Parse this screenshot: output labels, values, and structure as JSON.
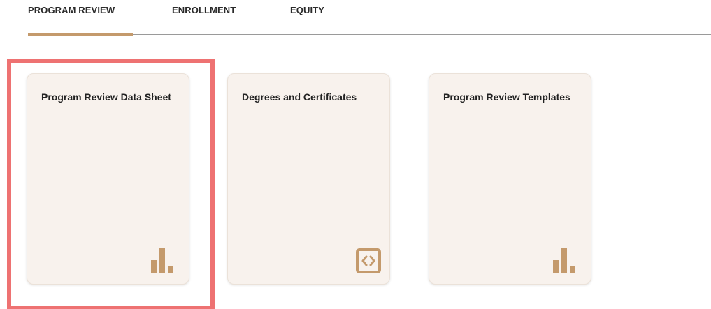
{
  "tabs": [
    {
      "label": "PROGRAM REVIEW",
      "active": true
    },
    {
      "label": "ENROLLMENT",
      "active": false
    },
    {
      "label": "EQUITY",
      "active": false
    }
  ],
  "cards": [
    {
      "title": "Program Review Data Sheet",
      "icon": "bar-chart-icon"
    },
    {
      "title": "Degrees and Certificates",
      "icon": "code-brackets-icon"
    },
    {
      "title": "Program Review Templates",
      "icon": "bar-chart-icon"
    }
  ],
  "colors": {
    "accent": "#c49a6c",
    "card_bg": "#f8f2ed",
    "highlight": "#ee7272"
  }
}
